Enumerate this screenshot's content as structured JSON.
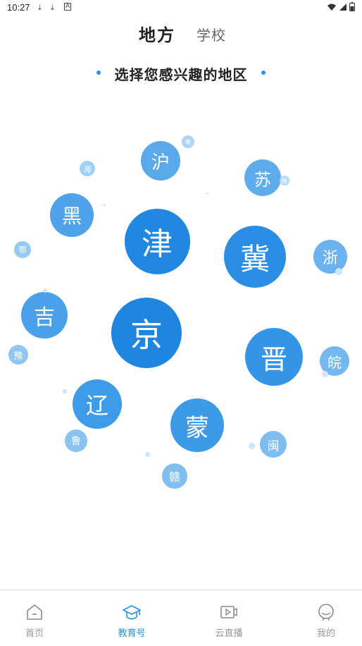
{
  "status_bar": {
    "time": "10:27"
  },
  "top_tabs": {
    "active": "地方",
    "inactive": "学校"
  },
  "subtitle": "选择您感兴趣的地区",
  "regions": [
    {
      "key": "jing",
      "label": "京"
    },
    {
      "key": "jin",
      "label": "津"
    },
    {
      "key": "ji",
      "label": "冀"
    },
    {
      "key": "jin2",
      "label": "晋"
    },
    {
      "key": "meng",
      "label": "蒙"
    },
    {
      "key": "liao",
      "label": "辽"
    },
    {
      "key": "jilin",
      "label": "吉"
    },
    {
      "key": "hei",
      "label": "黑"
    },
    {
      "key": "hu",
      "label": "沪"
    },
    {
      "key": "su",
      "label": "苏"
    },
    {
      "key": "zhe",
      "label": "浙"
    },
    {
      "key": "wan",
      "label": "皖"
    },
    {
      "key": "min",
      "label": "闽"
    },
    {
      "key": "gan",
      "label": "赣"
    },
    {
      "key": "lu",
      "label": "鲁"
    },
    {
      "key": "yu",
      "label": "豫"
    },
    {
      "key": "e",
      "label": "鄂"
    },
    {
      "key": "xiang",
      "label": "湘"
    },
    {
      "key": "yue",
      "label": "粤"
    },
    {
      "key": "gui",
      "label": "桂"
    }
  ],
  "bottom_nav": [
    {
      "label": "首页",
      "icon": "home-icon",
      "active": false
    },
    {
      "label": "教育号",
      "icon": "graduation-cap-icon",
      "active": true
    },
    {
      "label": "云直播",
      "icon": "video-icon",
      "active": false
    },
    {
      "label": "我的",
      "icon": "profile-icon",
      "active": false
    }
  ],
  "colors": {
    "accent": "#2a92e6",
    "bubble_dark": "#1f86e0",
    "bubble_light": "#a9d2f4"
  }
}
